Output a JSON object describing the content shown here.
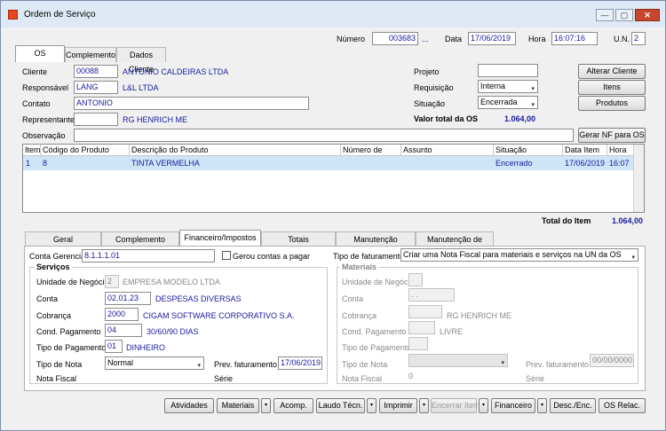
{
  "window": {
    "title": "Ordem de Serviço"
  },
  "header": {
    "numero_label": "Número",
    "numero": "003683",
    "ellipsis": "...",
    "data_label": "Data",
    "data": "17/06/2019",
    "hora_label": "Hora",
    "hora": "16:07:16",
    "un_label": "U.N.",
    "un": "2"
  },
  "top_tabs": [
    "OS",
    "Complemento",
    "Dados Cliente"
  ],
  "form": {
    "cliente_label": "Cliente",
    "cliente_code": "00088",
    "cliente_name": "ANTONIO CALDEIRAS LTDA",
    "responsavel_label": "Responsável",
    "responsavel_code": "LANG",
    "responsavel_name": "L&L LTDA",
    "contato_label": "Contato",
    "contato": "ANTONIO",
    "representante_label": "Representante",
    "representante_code": "",
    "representante_name": "RG HENRICH ME",
    "observacao_label": "Observação",
    "observacao": "",
    "projeto_label": "Projeto",
    "projeto": "",
    "requisicao_label": "Requisição",
    "requisicao": "Interna",
    "situacao_label": "Situação",
    "situacao": "Encerrada",
    "valor_label": "Valor total da OS",
    "valor": "1.064,00",
    "btn_alterar": "Alterar Cliente",
    "btn_itens": "Itens",
    "btn_produtos": "Produtos",
    "btn_gerar": "Gerar NF para OS"
  },
  "grid": {
    "headers": [
      "Item",
      "Código do Produto",
      "Descrição do Produto",
      "Número de Série",
      "Assunto",
      "Situação",
      "Data Item",
      "Hora"
    ],
    "rows": [
      {
        "item": "1",
        "codigo": "8",
        "descricao": "TINTA VERMELHA",
        "serie": "",
        "assunto": "",
        "situacao": "Encerrado",
        "data": "17/06/2019",
        "hora": "16:07"
      }
    ]
  },
  "total_item": {
    "label": "Total do Item",
    "value": "1.064,00"
  },
  "sub_tabs": [
    "Geral",
    "Complemento",
    "Financeiro/Impostos",
    "Totais",
    "Manutenção Industrial",
    "Manutenção de Frotas"
  ],
  "fin": {
    "conta_gerencial_label": "Conta Gerencial",
    "conta_gerencial": "8.1.1.1.01",
    "gerou_label": "Gerou contas a pagar",
    "tipo_fat_label": "Tipo de faturamento",
    "tipo_fat": "Criar uma Nota Fiscal para materiais e serviços na UN da OS",
    "servicos": {
      "title": "Serviços",
      "un_label": "Unidade de Negócio",
      "un_code": "2",
      "un_name": "EMPRESA MODELO LTDA",
      "conta_label": "Conta",
      "conta_code": "02.01.23",
      "conta_name": "DESPESAS DIVERSAS",
      "cobranca_label": "Cobrança",
      "cobranca_code": "2000",
      "cobranca_name": "CIGAM SOFTWARE CORPORATIVO S.A.",
      "cond_label": "Cond. Pagamento",
      "cond_code": "04",
      "cond_name": "30/60/90 DIAS",
      "tipo_pag_label": "Tipo de Pagamento",
      "tipo_pag_code": "01",
      "tipo_pag_name": "DINHEIRO",
      "tipo_nota_label": "Tipo de Nota",
      "tipo_nota": "Normal",
      "prev_label": "Prev. faturamento",
      "prev": "17/06/2019",
      "nf_label": "Nota Fiscal",
      "serie_label": "Série"
    },
    "materiais": {
      "title": "Materiais",
      "un_label": "Unidade de Negócio",
      "conta_label": "Conta",
      "conta_value": ". .",
      "cobranca_label": "Cobrança",
      "cobranca_name": "RG HENRICH ME",
      "cond_label": "Cond. Pagamento",
      "cond_name": "LIVRE",
      "tipo_pag_label": "Tipo de Pagamento",
      "tipo_nota_label": "Tipo de Nota",
      "prev_label": "Prev. faturamento",
      "prev": "00/00/0000",
      "nf_label": "Nota Fiscal",
      "nf_value": "0",
      "serie_label": "Série"
    }
  },
  "toolbar": {
    "atividades": "Atividades",
    "materiais": "Materiais",
    "acomp": "Acomp.",
    "laudo": "Laudo Técn.",
    "imprimir": "Imprimir",
    "encerrar": "Encerrar Item",
    "financeiro": "Financeiro",
    "desc": "Desc./Enc.",
    "os_relac": "OS Relac."
  },
  "icons": {
    "dropdown": "▾",
    "minimize": "—",
    "maximize": "▢",
    "close": "✕"
  }
}
